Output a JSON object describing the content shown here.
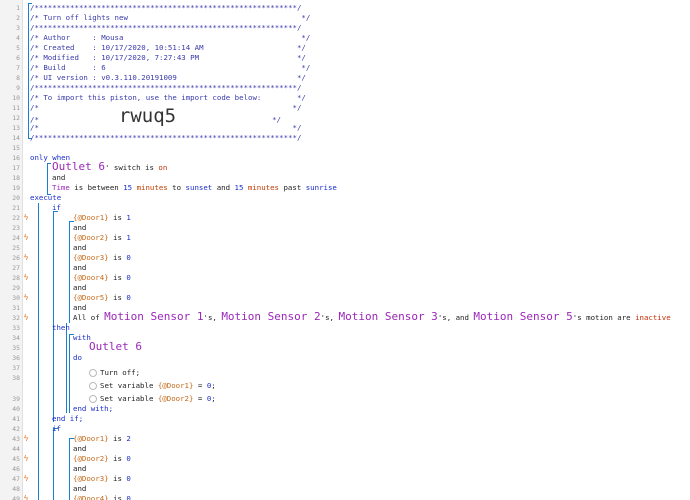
{
  "header": {
    "border": "/***********************************************************/",
    "title": "/* Turn off lights new                                       */",
    "author": "/* Author     : Mousa                                        */",
    "created": "/* Created    : 10/17/2020, 10:51:14 AM                     */",
    "modified": "/* Modified   : 10/17/2020, 7:27:43 PM                      */",
    "build": "/* Build      : 6                                            */",
    "ui_version": "/* UI version : v0.3.110.20191009                           */",
    "import_note": "/* To import this piston, use the import code below:        */",
    "blank_a": "/*                                                         */",
    "import_code_prefix": "/*",
    "import_code": "rwuq5",
    "import_code_suffix": "*/",
    "blank_b": "/*                                                         */"
  },
  "line_numbers": [
    "1",
    "2",
    "3",
    "4",
    "5",
    "6",
    "7",
    "8",
    "9",
    "10",
    "11",
    "12",
    "13",
    "14",
    "15",
    "16",
    "17",
    "18",
    "19",
    "20",
    "21",
    "22",
    "23",
    "24",
    "25",
    "26",
    "27",
    "28",
    "29",
    "30",
    "31",
    "32",
    "33",
    "34",
    "35",
    "36",
    "37",
    "38",
    "39",
    "40",
    "41",
    "42",
    "43",
    "44",
    "45",
    "46",
    "47",
    "48",
    "49"
  ],
  "code": {
    "only_when": "only when",
    "outlet6": "Outlet 6",
    "switch_is": "' switch is ",
    "on": "on",
    "and": "and",
    "time": "Time",
    "is_between": " is between ",
    "n15": "15",
    "minutes": "minutes",
    "to": " to ",
    "sunset": "sunset",
    "and_word": " and ",
    "past": " past ",
    "sunrise": "sunrise",
    "execute": "execute",
    "if": "if",
    "is": " is ",
    "door1": "{@Door1}",
    "door2": "{@Door2}",
    "door3": "{@Door3}",
    "door4": "{@Door4}",
    "door5": "{@Door5}",
    "v0": "0",
    "v1": "1",
    "v2": "2",
    "all_of": "All of ",
    "ms1": "Motion Sensor 1",
    "ms2": "Motion Sensor 2",
    "ms3": "Motion Sensor 3",
    "ms5": "Motion Sensor 5",
    "apos_s": "'s, ",
    "apos_s_and": "'s, and ",
    "motion_is": "'s motion are ",
    "inactive": "inactive",
    "then": "then",
    "with": "with",
    "do": "do",
    "turn_off": "Turn off;",
    "set_variable": "Set variable ",
    "eq": " = ",
    "semi": ";",
    "end_with": "end with;",
    "end_if": "end if;"
  },
  "colors": {
    "keyword": "#1a2dcc",
    "device": "#9b27b9",
    "variable": "#c56a1a",
    "bolt": "#e8721c",
    "tree_line": "#1a7fcc"
  },
  "icons": {
    "condition_marker": "lightning-bolt-icon",
    "statement_marker": "circle-icon"
  }
}
